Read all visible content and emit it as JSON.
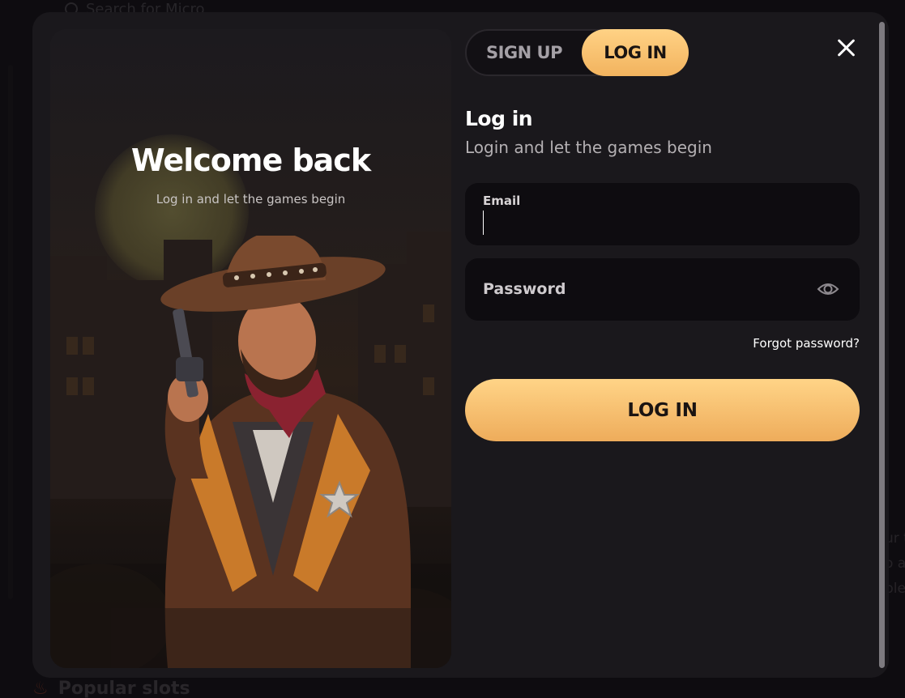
{
  "background": {
    "search_placeholder": "Search for Micro",
    "section_title": "Popular slots",
    "side_text": [
      "ur t",
      "o a",
      "ble"
    ]
  },
  "hero": {
    "title": "Welcome back",
    "subtitle": "Log in and let the games begin"
  },
  "tabs": {
    "signup": "SIGN UP",
    "login": "LOG IN",
    "active": "login"
  },
  "form": {
    "title": "Log in",
    "subtitle": "Login and let the games begin",
    "email_label": "Email",
    "email_value": "",
    "password_placeholder": "Password",
    "forgot_label": "Forgot password?",
    "submit_label": "LOG IN"
  },
  "colors": {
    "accent_top": "#ffd285",
    "accent_bottom": "#f2b35e",
    "modal_bg": "#1a181c",
    "field_bg": "#0e0c10"
  },
  "icons": {
    "close": "close-icon",
    "password_toggle": "eye-icon",
    "search": "search-icon",
    "flame": "flame-icon"
  }
}
